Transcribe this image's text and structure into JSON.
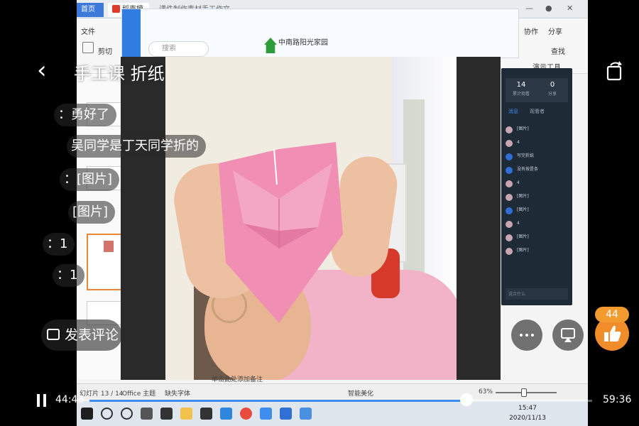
{
  "player": {
    "title": "手工课 折纸",
    "current_time": "44:43",
    "total_time": "59:36",
    "progress": 0.75,
    "comment_button": "发表评论",
    "like_count": "44",
    "accent_color": "#3d8ef0",
    "like_color": "#f08c2a"
  },
  "danmaku": [
    {
      "text": "：勇好了"
    },
    {
      "text": "吴同学是丁天同学折的"
    },
    {
      "text": "：[图片]"
    },
    {
      "text": "[图片]"
    },
    {
      "text": "：1"
    },
    {
      "text": "：1"
    }
  ],
  "desktop": {
    "tabs": [
      "首页",
      "稻壳模板",
      "课件制作素材手工作文"
    ],
    "ribbon": {
      "file": "文件",
      "cut": "剪切",
      "search": "查找",
      "collab": "协作",
      "share": "分享",
      "presenter": "演示工具",
      "outline": "大纲"
    },
    "status": {
      "slide": "幻灯片 13 / 14",
      "theme": "Office 主题",
      "font": "缺失字体",
      "beautify": "智能美化",
      "zoom": "63%",
      "notes": "单击此处添加备注"
    },
    "clock_time": "15:47",
    "clock_date": "2020/11/13"
  },
  "meeting": {
    "group_name": "中南路阳光家园",
    "search_placeholder": "搜索",
    "stats": [
      {
        "value": "14",
        "label": "累计观看"
      },
      {
        "value": "0",
        "label": "分享"
      }
    ],
    "panel_tabs": [
      "消息",
      "观看者"
    ],
    "messages": [
      "[图片]",
      "4",
      "写完折纸",
      "没有按是条",
      "4",
      "[图片]",
      "[图片]",
      "4",
      "[图片]",
      "[图片]"
    ],
    "input_placeholder": "说点什么"
  }
}
